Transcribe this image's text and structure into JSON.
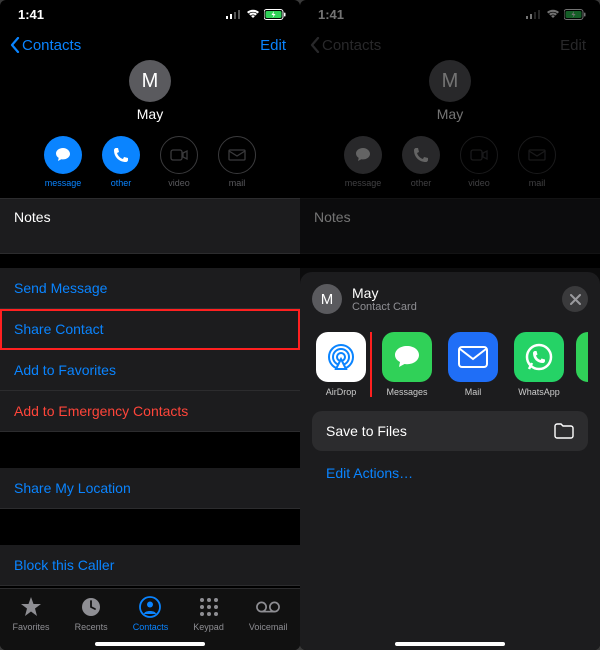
{
  "status": {
    "time": "1:41"
  },
  "nav": {
    "back": "Contacts",
    "edit": "Edit"
  },
  "contact": {
    "initial": "M",
    "name": "May"
  },
  "quick": {
    "message": "message",
    "other": "other",
    "video": "video",
    "mail": "mail"
  },
  "notes_label": "Notes",
  "actions": {
    "send_message": "Send Message",
    "share_contact": "Share Contact",
    "add_favorites": "Add to Favorites",
    "add_emergency": "Add to Emergency Contacts",
    "share_location": "Share My Location",
    "block": "Block this Caller"
  },
  "tabs": {
    "favorites": "Favorites",
    "recents": "Recents",
    "contacts": "Contacts",
    "keypad": "Keypad",
    "voicemail": "Voicemail"
  },
  "sheet": {
    "initial": "M",
    "name": "May",
    "sub": "Contact Card",
    "apps": {
      "airdrop": "AirDrop",
      "messages": "Messages",
      "mail": "Mail",
      "whatsapp": "WhatsApp"
    },
    "save_files": "Save to Files",
    "edit_actions": "Edit Actions…"
  }
}
